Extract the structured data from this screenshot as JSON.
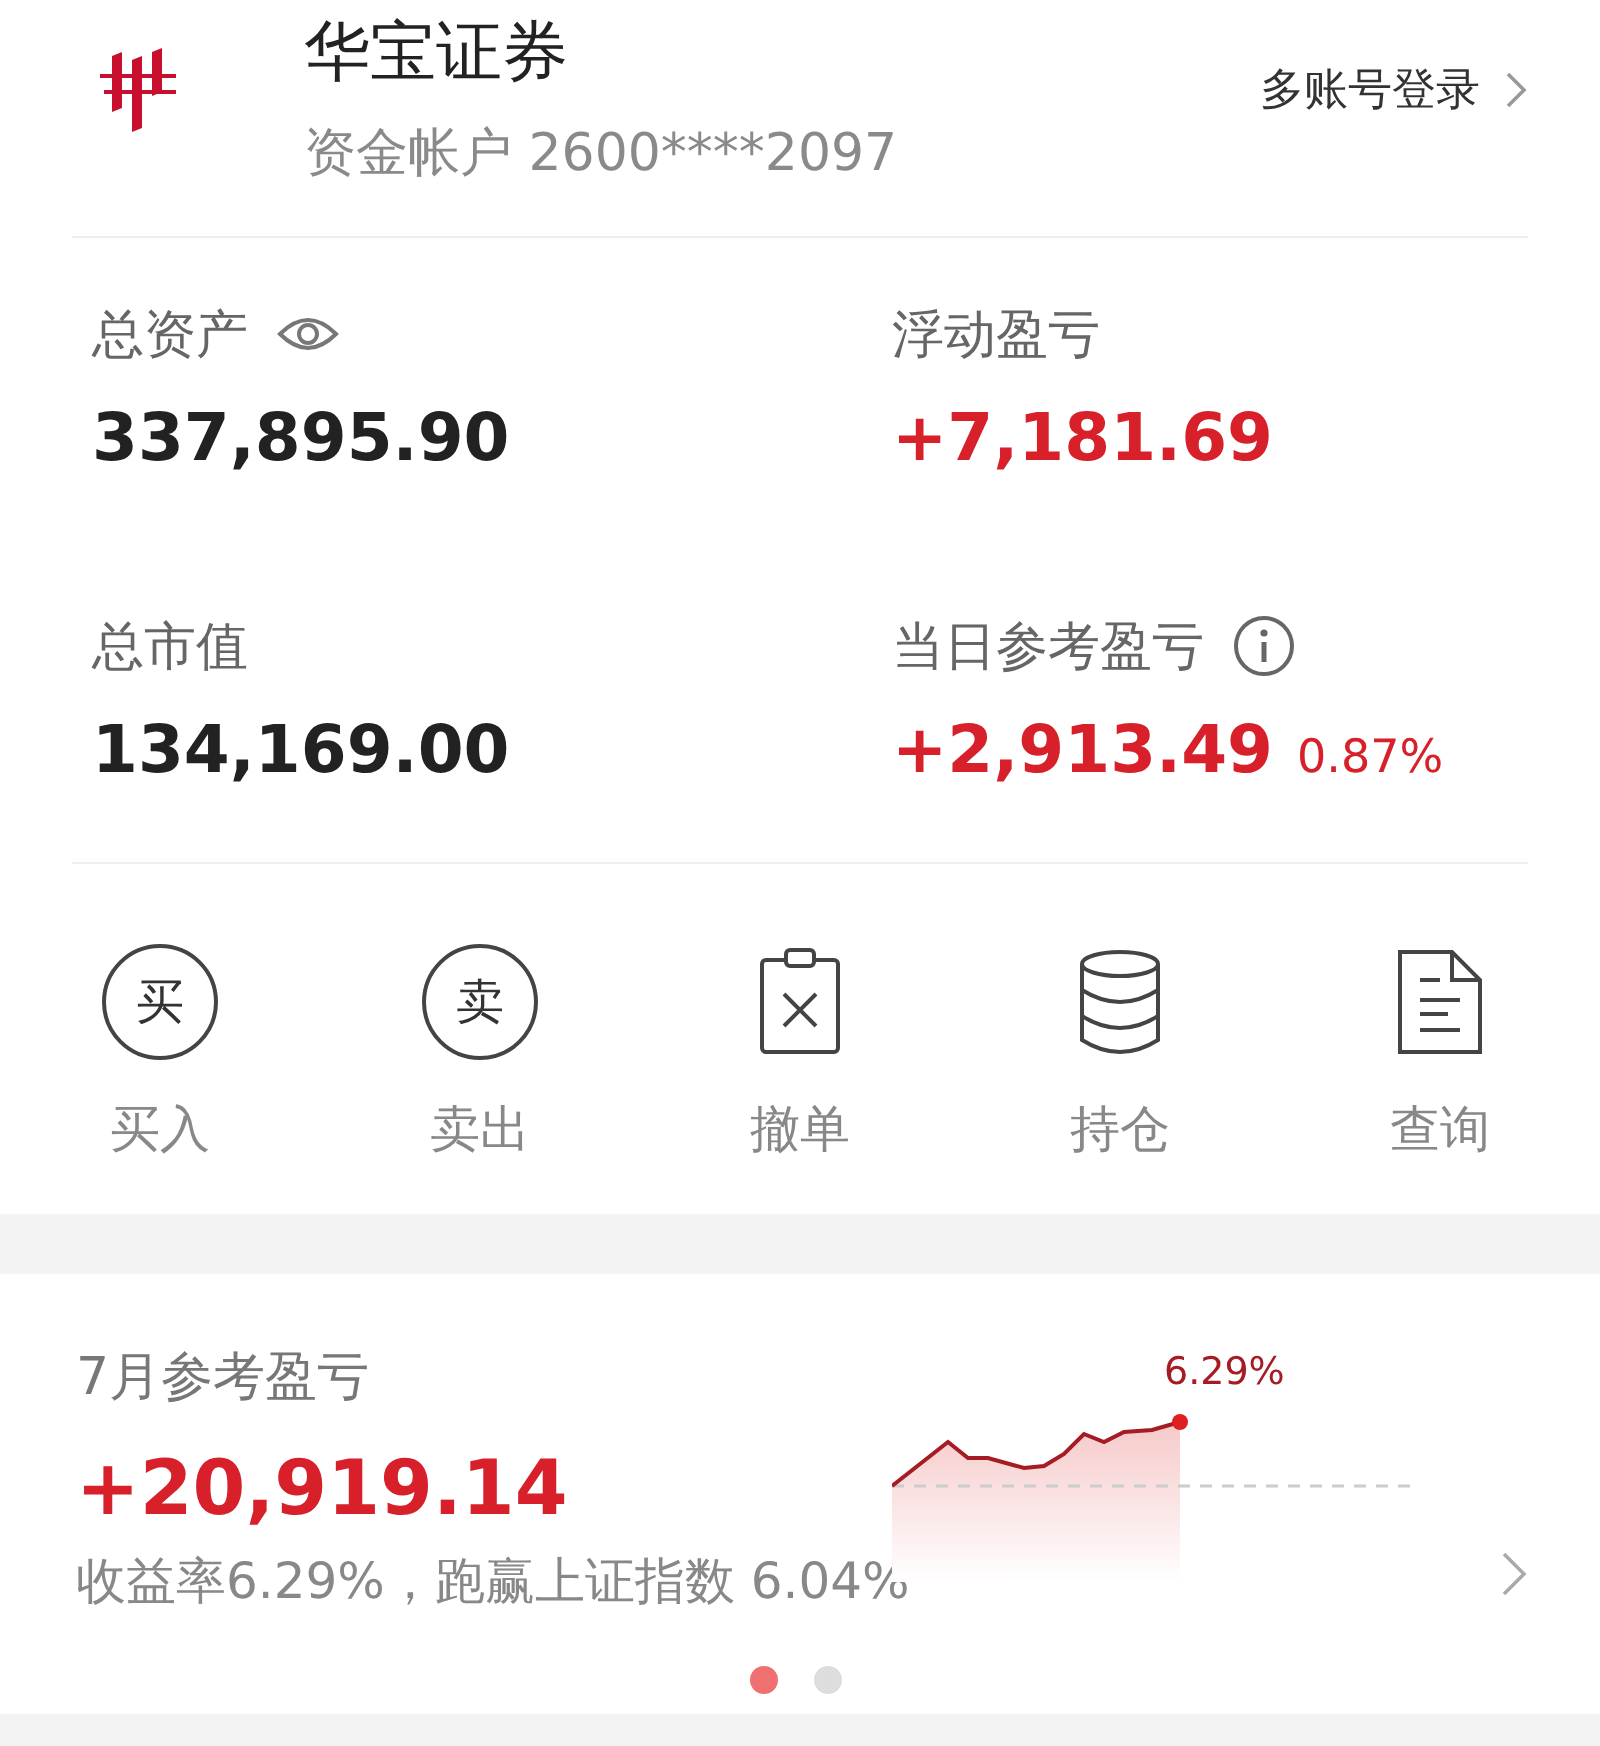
{
  "header": {
    "broker_name": "华宝证券",
    "account": "资金帐户 2600****2097",
    "multi_login": "多账号登录"
  },
  "stats": [
    {
      "label": "总资产",
      "value": "337,895.90",
      "kind": "eye",
      "gain": false
    },
    {
      "label": "浮动盈亏",
      "value": "+7,181.69",
      "kind": "plain",
      "gain": true
    },
    {
      "label": "总市值",
      "value": "134,169.00",
      "kind": "plain",
      "gain": false
    },
    {
      "label": "当日参考盈亏",
      "value": "+2,913.49",
      "percent": "0.87%",
      "kind": "info",
      "gain": true
    }
  ],
  "actions": [
    {
      "label": "买入",
      "kind": "circle",
      "glyph": "买"
    },
    {
      "label": "卖出",
      "kind": "circle",
      "glyph": "卖"
    },
    {
      "label": "撤单",
      "kind": "cancel"
    },
    {
      "label": "持仓",
      "kind": "stack"
    },
    {
      "label": "查询",
      "kind": "document"
    }
  ],
  "monthly": {
    "title": "7月参考盈亏",
    "value": "+20,919.14",
    "summary": "收益率6.29%，跑赢上证指数 6.04%",
    "sparkline_label": "6.29%"
  },
  "pager": [
    {
      "selected": true
    },
    {
      "selected": false
    }
  ]
}
